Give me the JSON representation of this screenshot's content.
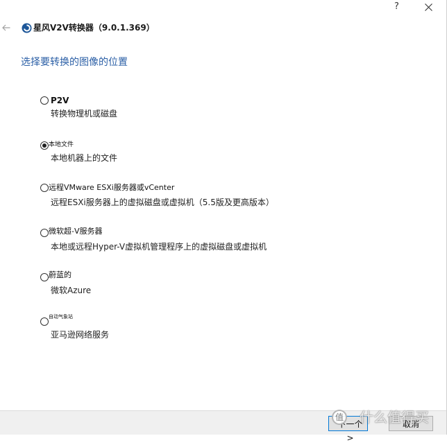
{
  "window": {
    "help_label": "?"
  },
  "header": {
    "title": "星风V2V转换器（9.0.1.369）"
  },
  "page": {
    "heading": "选择要转换的图像的位置"
  },
  "options": [
    {
      "label": "P2V",
      "description": "转换物理机或磁盘",
      "selected": false
    },
    {
      "label": "本地文件",
      "description": "本地机器上的文件",
      "selected": true
    },
    {
      "label": "远程VMware ESXi服务器或vCenter",
      "description": "远程ESXi服务器上的虚拟磁盘或虚拟机（5.5版及更高版本）",
      "selected": false
    },
    {
      "label": "微软超-V服务器",
      "description": "本地或远程Hyper-V虚拟机管理程序上的虚拟磁盘或虚拟机",
      "selected": false
    },
    {
      "label": "蔚蓝的",
      "description": "微软Azure",
      "selected": false
    },
    {
      "label": "自动气象站",
      "description": "亚马逊网络服务",
      "selected": false
    }
  ],
  "footer": {
    "next_label": "下一个>",
    "cancel_label": "取消"
  },
  "watermark": {
    "logo": "值",
    "text": "什么值得买"
  },
  "icons": {
    "back": "back-arrow-icon",
    "close": "close-icon",
    "logo": "app-logo-icon"
  },
  "colors": {
    "heading": "#2b5fa6",
    "footer_bg": "#f0f0f0",
    "focus_border": "#0078d7",
    "button_bg": "#e1e1e1"
  }
}
